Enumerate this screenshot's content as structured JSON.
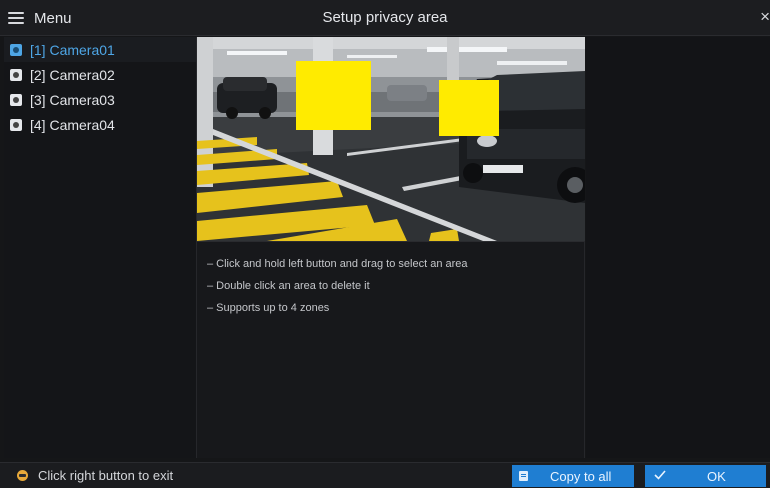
{
  "header": {
    "menu_label": "Menu",
    "title": "Setup privacy area",
    "close_glyph": "×"
  },
  "sidebar": {
    "items": [
      {
        "label": "[1] Camera01",
        "active": true,
        "icon": "camera-icon"
      },
      {
        "label": "[2] Camera02",
        "active": false,
        "icon": "camera-icon"
      },
      {
        "label": "[3] Camera03",
        "active": false,
        "icon": "camera-icon"
      },
      {
        "label": "[4] Camera04",
        "active": false,
        "icon": "camera-icon"
      }
    ]
  },
  "video": {
    "zone_count": 2,
    "zone_color": "#ffeb00"
  },
  "instructions": {
    "lines": [
      "– Click and hold left button and drag to select an area",
      "– Double click an area to delete it",
      "– Supports up to 4 zones"
    ]
  },
  "footer": {
    "exit_hint": "Click right button to exit",
    "copy_label": "Copy to all",
    "ok_label": "OK"
  },
  "colors": {
    "accent": "#1f7ed2",
    "active_text": "#4ea6e6",
    "background": "#151618"
  }
}
